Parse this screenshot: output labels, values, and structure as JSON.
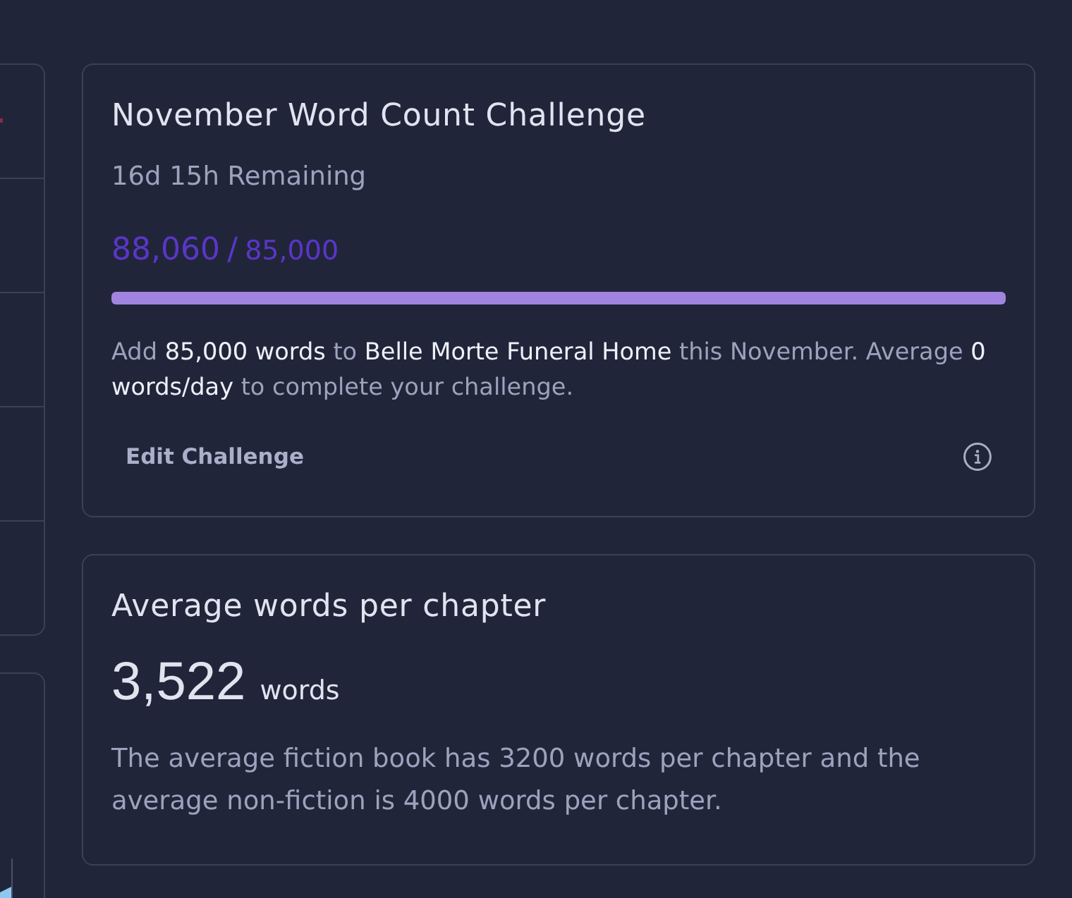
{
  "challenge_card": {
    "title": "November Word Count Challenge",
    "remaining": "16d 15h Remaining",
    "progress": {
      "current": "88,060",
      "separator": "/",
      "target": "85,000",
      "level": 1
    },
    "description": "Add **85,000 words** to **Belle Morte Funeral Home** this November. Average **0 words/day** to complete your challenge.",
    "edit_button": "Edit Challenge"
  },
  "chapter_card": {
    "title": "Average words per chapter",
    "value": "3,522",
    "unit": "words",
    "note": "The average fiction book has 3200 words per chapter and the average non-fiction is 4000 words per chapter."
  }
}
